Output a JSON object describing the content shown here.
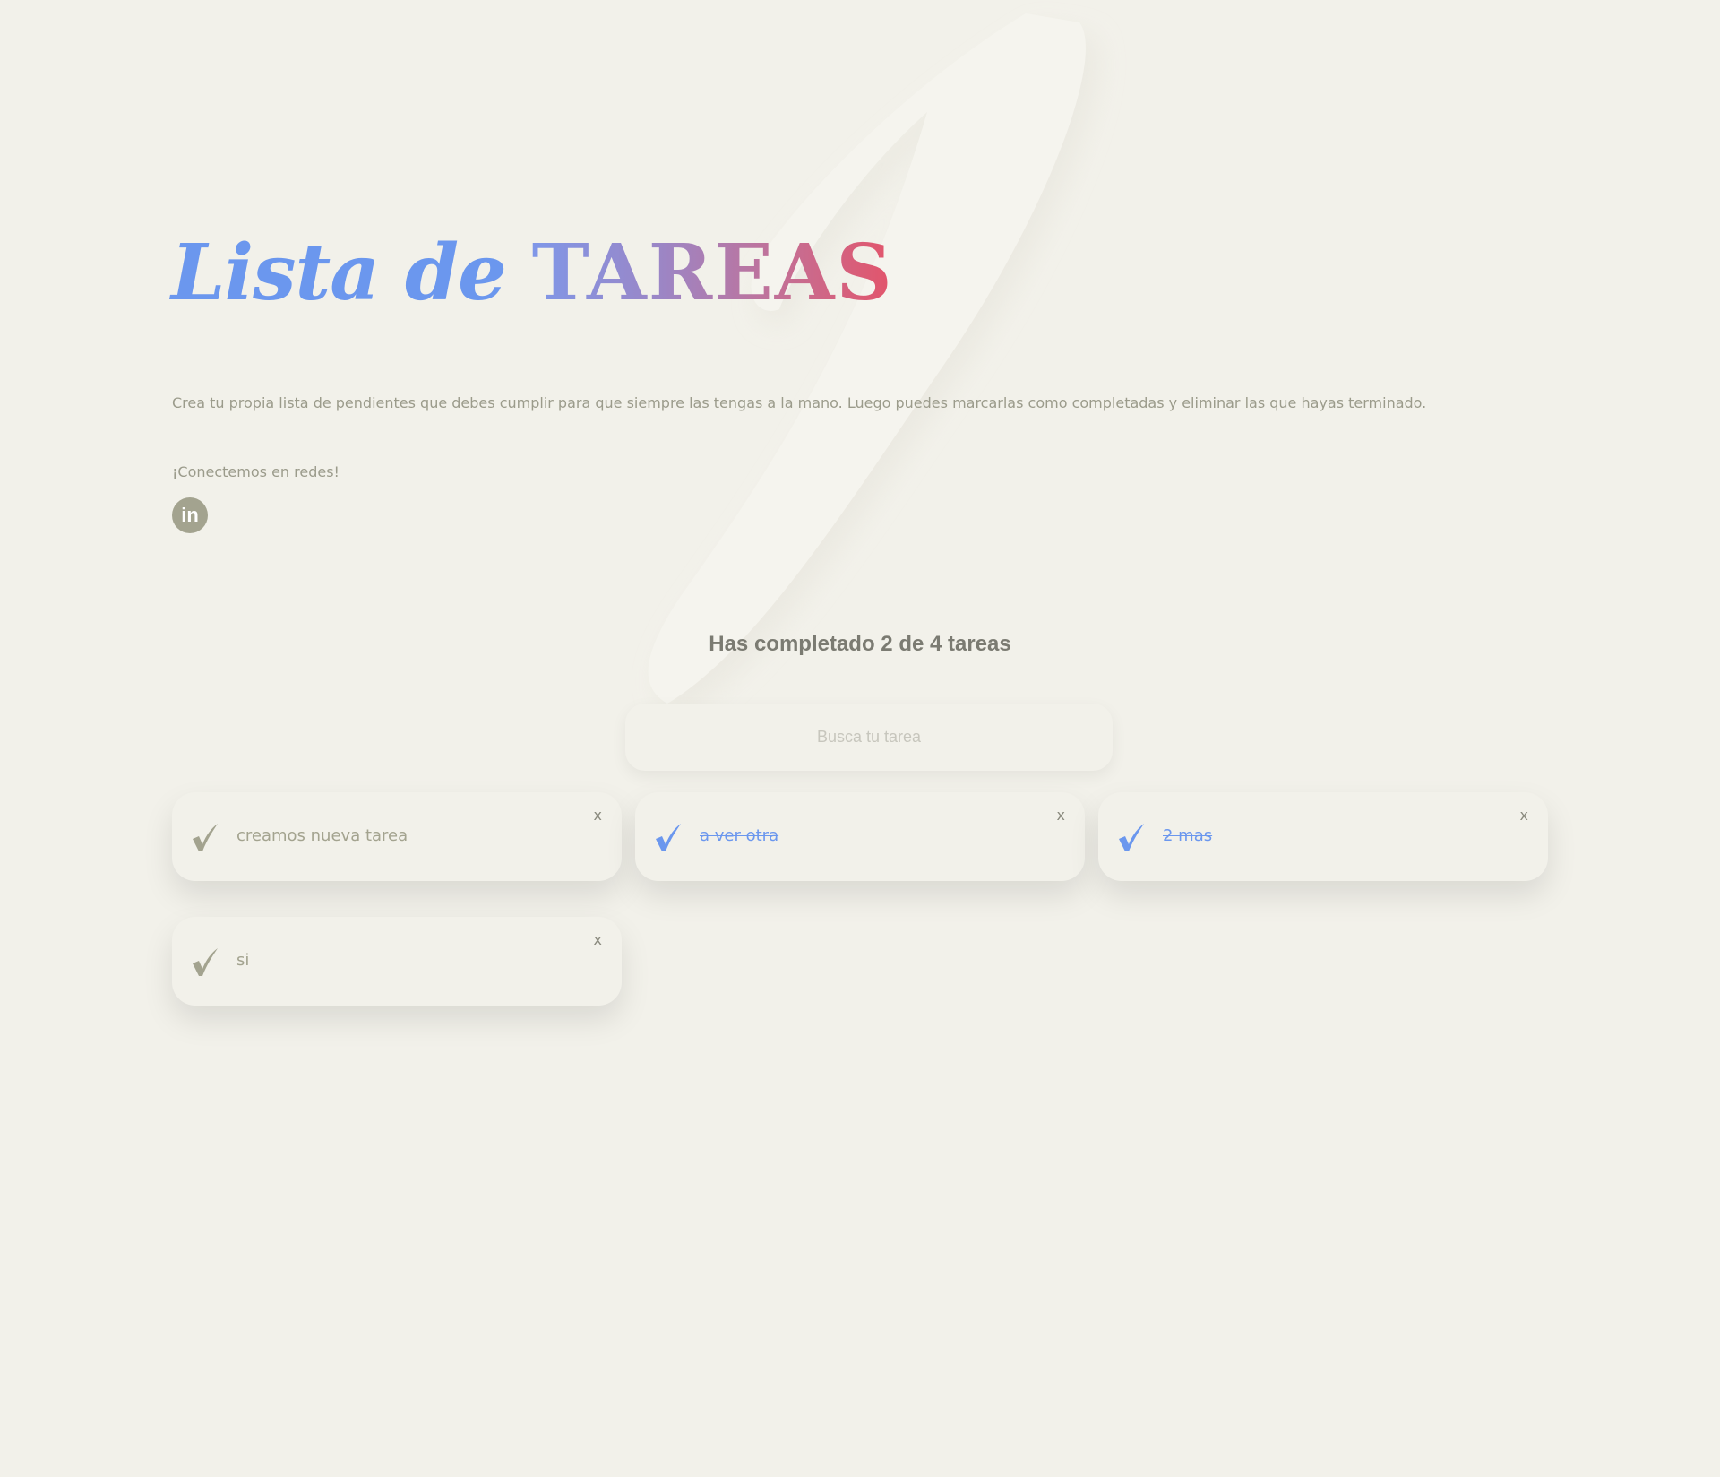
{
  "header": {
    "title_part1": "Lista de",
    "title_part2": "TAREAS",
    "description": "Crea tu propia lista de pendientes que debes cumplir para que siempre las tengas a la mano. Luego puedes marcarlas como completadas y eliminar las que hayas terminado.",
    "social_label": "¡Conectemos en redes!",
    "linkedin_icon": "linkedin-icon",
    "linkedin_glyph": "in"
  },
  "counter": {
    "text": "Has completado 2 de 4 tareas"
  },
  "search": {
    "placeholder": "Busca tu tarea",
    "value": ""
  },
  "tasks": [
    {
      "text": "creamos nueva tarea",
      "completed": false,
      "delete_label": "x"
    },
    {
      "text": "a ver otra",
      "completed": true,
      "delete_label": "x"
    },
    {
      "text": "2 mas",
      "completed": true,
      "delete_label": "x"
    },
    {
      "text": "si",
      "completed": false,
      "delete_label": "x"
    }
  ],
  "colors": {
    "background": "#f2f1ea",
    "muted": "#a3a38f",
    "accent_blue": "#6b97ee",
    "accent_red": "#e3546a",
    "counter_text": "#7b7b72"
  }
}
